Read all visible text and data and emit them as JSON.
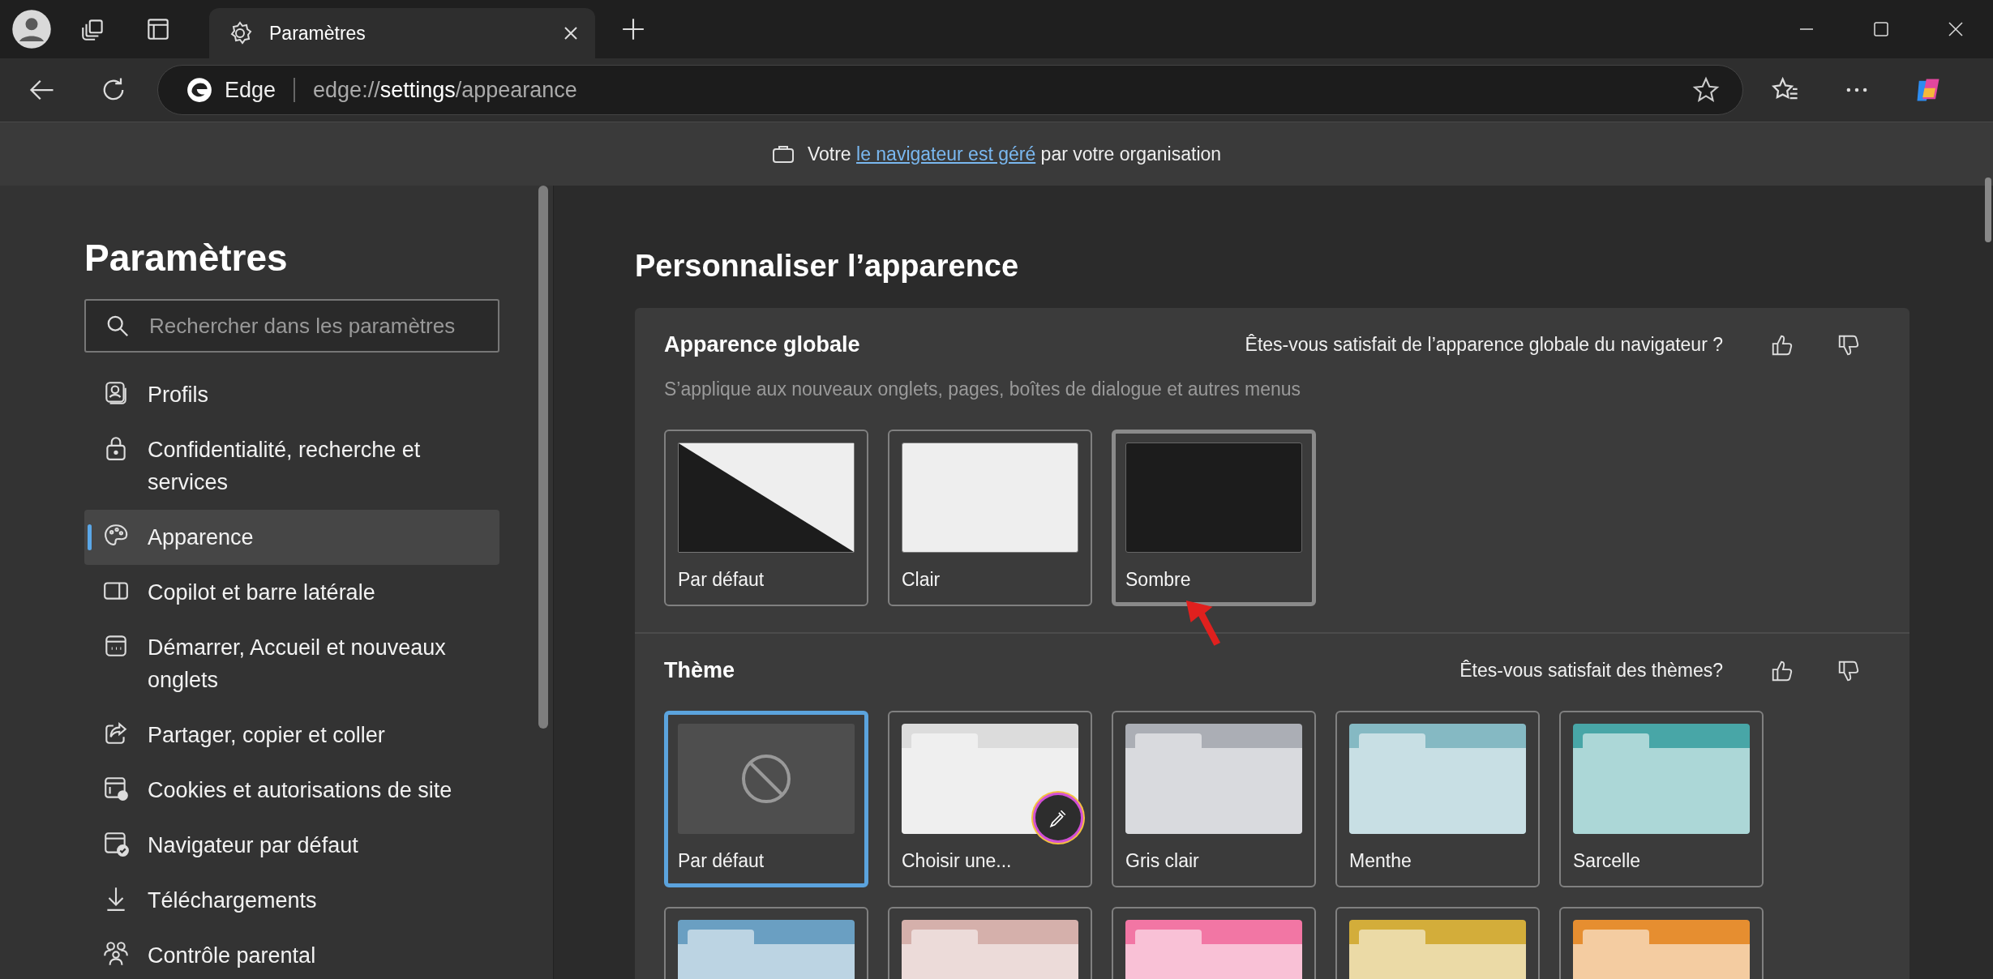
{
  "tab": {
    "title": "Paramètres"
  },
  "address_bar": {
    "site_label": "Edge",
    "url": "edge://**settings**/appearance"
  },
  "banner": {
    "before": "Votre",
    "link": "le navigateur est géré",
    "after": "par votre organisation"
  },
  "sidebar": {
    "title": "Paramètres",
    "search": {
      "placeholder": "Rechercher dans les paramètres"
    },
    "items": [
      {
        "kind": "profile",
        "label": "Profils",
        "selected": false
      },
      {
        "kind": "lock",
        "label": "Confidentialité, recherche et services",
        "selected": false
      },
      {
        "kind": "palette",
        "label": "Apparence",
        "selected": true
      },
      {
        "kind": "sidebar",
        "label": "Copilot et barre latérale",
        "selected": false
      },
      {
        "kind": "start",
        "label": "Démarrer, Accueil et nouveaux onglets",
        "selected": false
      },
      {
        "kind": "share",
        "label": "Partager, copier et coller",
        "selected": false
      },
      {
        "kind": "cookies",
        "label": "Cookies et autorisations de site",
        "selected": false
      },
      {
        "kind": "default",
        "label": "Navigateur par défaut",
        "selected": false
      },
      {
        "kind": "download",
        "label": "Téléchargements",
        "selected": false
      },
      {
        "kind": "family",
        "label": "Contrôle parental",
        "selected": false
      }
    ]
  },
  "main": {
    "title": "Personnaliser l’apparence",
    "global": {
      "title": "Apparence globale",
      "feedback": "Êtes-vous satisfait de l’apparence globale du navigateur ?",
      "description": "S’applique aux nouveaux onglets, pages, boîtes de dialogue et autres menus",
      "options": [
        {
          "kind": "split",
          "label": "Par défaut",
          "selected": false
        },
        {
          "kind": "light",
          "label": "Clair",
          "selected": false
        },
        {
          "kind": "dark",
          "label": "Sombre",
          "selected": true
        }
      ]
    },
    "theme": {
      "title": "Thème",
      "feedback": "Êtes-vous satisfait des thèmes?",
      "options": [
        {
          "kind": "none",
          "label": "Par défaut",
          "selected": true
        },
        {
          "kind": "custom",
          "label": "Choisir une...",
          "selected": false,
          "color": "#dcdcdc"
        },
        {
          "kind": "color",
          "label": "Gris clair",
          "selected": false,
          "color": "#abaeb5"
        },
        {
          "kind": "color",
          "label": "Menthe",
          "selected": false,
          "color": "#85b9c3"
        },
        {
          "kind": "color",
          "label": "Sarcelle",
          "selected": false,
          "color": "#48a6a7"
        },
        {
          "kind": "color",
          "selected": false,
          "color": "#6a9fc2"
        },
        {
          "kind": "color",
          "selected": false,
          "color": "#d5b0ab"
        },
        {
          "kind": "color",
          "selected": false,
          "color": "#f276a4"
        },
        {
          "kind": "color",
          "selected": false,
          "color": "#d3ad3a"
        },
        {
          "kind": "color",
          "selected": false,
          "color": "#e68e30"
        }
      ]
    }
  }
}
